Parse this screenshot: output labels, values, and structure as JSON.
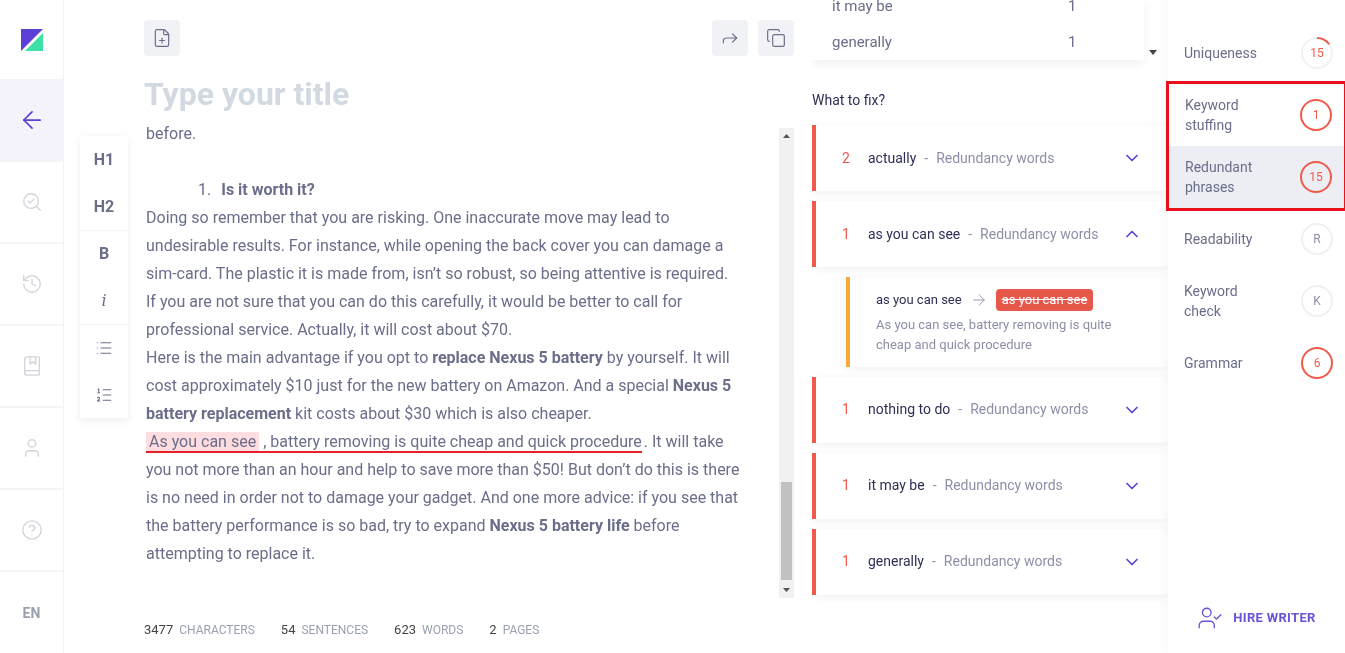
{
  "nav": {
    "items": [
      {
        "selected": true
      },
      {
        "selected": false
      },
      {
        "selected": false
      },
      {
        "selected": false
      },
      {
        "selected": false
      },
      {
        "selected": false
      }
    ],
    "language": "EN"
  },
  "editor": {
    "title_placeholder": "Type your title",
    "format_buttons": [
      {
        "kind": "text",
        "label": "H1"
      },
      {
        "kind": "text",
        "label": "H2"
      },
      {
        "kind": "bold",
        "label": "B"
      },
      {
        "kind": "italic",
        "label": "i"
      },
      {
        "kind": "bullets"
      },
      {
        "kind": "numbers"
      }
    ],
    "paragraphs": [
      {
        "kind": "text",
        "text": "before."
      },
      {
        "kind": "spacer"
      },
      {
        "kind": "numbered",
        "number": "1.",
        "text": "Is it worth it?"
      },
      {
        "kind": "text",
        "text": "Doing so remember that you are risking. One inaccurate move may lead to undesirable results. For instance, while opening the back cover you can damage a sim-card. The plastic it is made from, isn’t so robust, so being attentive is required."
      },
      {
        "kind": "text",
        "text": "If you are not sure that you can do this carefully, it would be better to call for professional service. Actually, it will cost about $70."
      },
      {
        "kind": "text",
        "text": "Here is the main advantage if you opt to **replace Nexus 5 battery** by yourself. It will cost approximately $10 just for the new battery on Amazon. And a special **Nexus 5 battery replacement**  kit costs about $30 which is also cheaper."
      },
      {
        "kind": "flagged",
        "phrase": "As you can see",
        "sentence": ", battery removing is quite cheap and quick procedure",
        "rest": ". It will take you not more than an hour and help to save more than $50! But don’t do this is there is no need in order not to damage your gadget. And one more advice: if you see that the battery performance is so bad, try to expand **Nexus 5 battery life** before attempting to replace it."
      }
    ],
    "stats": [
      {
        "value": "3477",
        "label": "CHARACTERS"
      },
      {
        "value": "54",
        "label": "SENTENCES"
      },
      {
        "value": "623",
        "label": "WORDS"
      },
      {
        "value": "2",
        "label": "PAGES"
      }
    ]
  },
  "phrase_table": {
    "rows": [
      {
        "phrase": "it may be",
        "count": "1"
      },
      {
        "phrase": "generally",
        "count": "1"
      }
    ]
  },
  "fixes": {
    "heading": "What to fix?",
    "items": [
      {
        "count": "2",
        "phrase": "actually",
        "separator": "-",
        "category": "Redundancy words",
        "expanded": false
      },
      {
        "count": "1",
        "phrase": "as you can see",
        "separator": "-",
        "category": "Redundancy words",
        "expanded": true,
        "suggestion": {
          "original": "as you can see",
          "removed": "as you can see",
          "context": "As you can see, battery removing is quite cheap and quick procedure"
        }
      },
      {
        "count": "1",
        "phrase": "nothing to do",
        "separator": "-",
        "category": "Redundancy words",
        "expanded": false
      },
      {
        "count": "1",
        "phrase": "it may be",
        "separator": "-",
        "category": "Redundancy words",
        "expanded": false
      },
      {
        "count": "1",
        "phrase": "generally",
        "separator": "-",
        "category": "Redundancy words",
        "expanded": false
      }
    ]
  },
  "checks": [
    {
      "label": "Uniqueness",
      "value": "15",
      "kind": "progress",
      "selected": false,
      "framed": false
    },
    {
      "label": "Keyword stuffing",
      "value": "1",
      "kind": "alert",
      "selected": false,
      "framed": true
    },
    {
      "label": "Redundant phrases",
      "value": "15",
      "kind": "alert",
      "selected": true,
      "framed": true
    },
    {
      "label": "Readability",
      "value": "R",
      "kind": "idle",
      "selected": false,
      "framed": false
    },
    {
      "label": "Keyword check",
      "value": "K",
      "kind": "idle",
      "selected": false,
      "framed": false
    },
    {
      "label": "Grammar",
      "value": "6",
      "kind": "alert",
      "selected": false,
      "framed": false
    }
  ],
  "hire_button": "HIRE WRITER"
}
